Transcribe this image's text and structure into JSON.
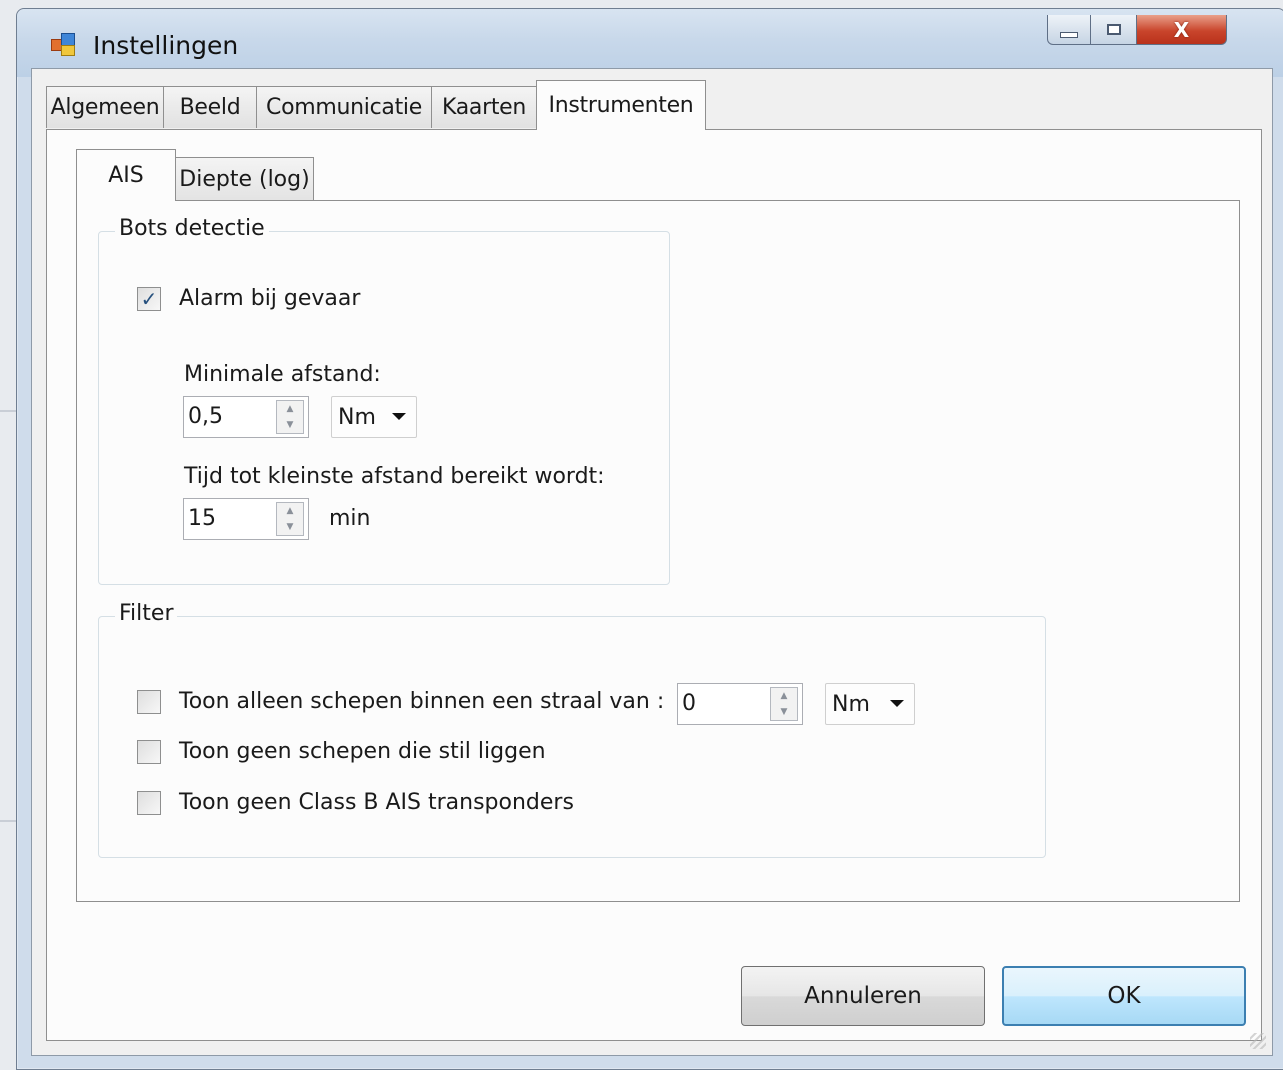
{
  "window": {
    "title": "Instellingen",
    "controls": {
      "minimize": "minimize",
      "maximize": "maximize",
      "close": "close"
    }
  },
  "tabs": [
    {
      "label": "Algemeen"
    },
    {
      "label": "Beeld"
    },
    {
      "label": "Communicatie"
    },
    {
      "label": "Kaarten"
    },
    {
      "label": "Instrumenten",
      "active": true
    }
  ],
  "subtabs": [
    {
      "label": "AIS",
      "active": true
    },
    {
      "label": "Diepte (log)"
    }
  ],
  "collision": {
    "title": "Bots detectie",
    "alarm": {
      "label": "Alarm bij gevaar",
      "checked": true,
      "mark": "✓"
    },
    "min_distance": {
      "label": "Minimale afstand:",
      "value": "0,5",
      "unit": "Nm"
    },
    "time_to_cpa": {
      "label": "Tijd tot kleinste afstand bereikt wordt:",
      "value": "15",
      "unit": "min"
    }
  },
  "filter": {
    "title": "Filter",
    "radius": {
      "label": "Toon alleen schepen binnen een straal van :",
      "checked": false,
      "value": "0",
      "unit": "Nm"
    },
    "stationary": {
      "label": "Toon geen schepen die stil liggen",
      "checked": false
    },
    "classb": {
      "label": "Toon geen Class B AIS transponders",
      "checked": false
    }
  },
  "buttons": {
    "cancel": "Annuleren",
    "ok": "OK"
  },
  "icons": {
    "spin_up": "▲",
    "spin_down": "▼",
    "close_glyph": "X"
  }
}
